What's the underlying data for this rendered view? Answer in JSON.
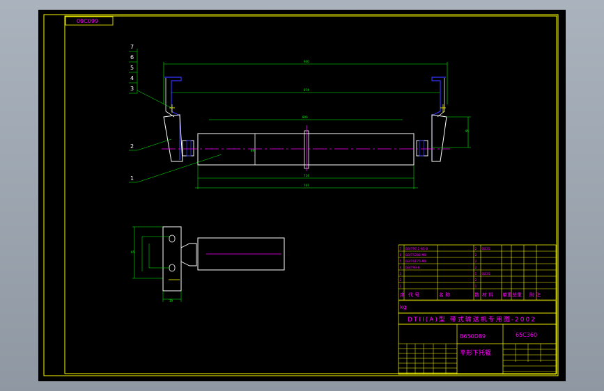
{
  "colors": {
    "background": "#000000",
    "frame": "#ffff00",
    "part": "#ffffff",
    "dimension": "#00ff00",
    "centerline": "#ff00ff",
    "accent": "#3333ff",
    "text": "#ff00ff",
    "table": "#ffff00"
  },
  "drawing_code": "09C099",
  "balloons": [
    "7",
    "6",
    "5",
    "4",
    "3",
    "2",
    "1"
  ],
  "dimensions": {
    "overall_width": "940",
    "inner_width": "874",
    "roll_length": "800",
    "shaft_length": "714",
    "total_length": "767",
    "height": "95",
    "diameter": "89",
    "side_height": "65",
    "side_width": "39"
  },
  "parts_table": {
    "rows": [
      [
        "7",
        "GB/T97.1-85-8",
        "",
        "2",
        "Q235",
        "",
        "",
        ""
      ],
      [
        "6",
        "GB/T5783-M8",
        "",
        "2",
        "",
        "",
        "",
        ""
      ],
      [
        "5",
        "GB/T6170-M8",
        "",
        "2",
        "",
        "",
        "",
        ""
      ],
      [
        "4",
        "GB/T93-8",
        "",
        "2",
        "",
        "",
        "",
        ""
      ],
      [
        "3",
        "",
        "",
        "1",
        "Q235",
        "",
        "",
        ""
      ],
      [
        "2",
        "",
        "",
        "2",
        "",
        "",
        "",
        ""
      ],
      [
        "1",
        "",
        "",
        "1",
        "",
        "",
        "",
        ""
      ]
    ],
    "header": [
      "序",
      "代    号",
      "名   称",
      "数",
      "材   料",
      "单重",
      "总重",
      "附    注"
    ]
  },
  "title_block": {
    "series": "DTII(A)型  带式输送机专用图-2002",
    "drawing_no": "B650D89",
    "part_code": "65C360",
    "part_name": "平形下托辊",
    "weight_note": "kg"
  }
}
